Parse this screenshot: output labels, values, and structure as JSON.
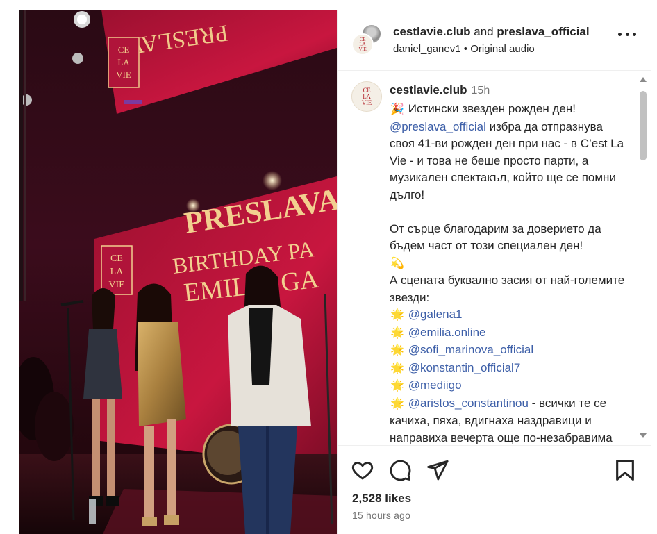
{
  "post": {
    "header": {
      "user1": "cestlavie.club",
      "and_word": "and",
      "user2": "preslava_official",
      "audio_user": "daniel_ganev1",
      "separator": "•",
      "audio_label": "Original audio",
      "more_icon": "more-horizontal-icon"
    },
    "logo": {
      "line1": "CE",
      "line2": "LA",
      "line3": "VIE"
    },
    "caption": {
      "username": "cestlavie.club",
      "time": "15h",
      "emoji_party": "🎉",
      "line_intro": "Истински звезден рожден ден!",
      "mention_preslava": "@preslava_official",
      "para1_rest": " избра да отпразнува своя 41-ви рожден ден при нас - в C’est La Vie - и това не беше просто парти, а музикален спектакъл, който ще се помни дълго!",
      "para2": "От сърце благодарим за доверието да бъдем част от този специален ден!",
      "emoji_dizzy": "💫",
      "para3": "А сцената буквално засия от най-големите звезди:",
      "emoji_sparkle": "🌟",
      "mentions": [
        "@galena1",
        "@emilia.online",
        "@sofi_marinova_official",
        "@konstantin_official7",
        "@mediigo",
        "@aristos_constantinou"
      ],
      "para4_rest": " - всички те се качиха, пяха, вдигнаха наздравици и направиха вечерта още по-незабравима"
    },
    "actions": {
      "like_icon": "heart-icon",
      "comment_icon": "comment-icon",
      "share_icon": "share-icon",
      "save_icon": "bookmark-icon"
    },
    "likes": "2,528 likes",
    "time_ago": "15 hours ago",
    "media": {
      "screen_text_1": "PRESLAVA",
      "screen_text_2": "BIRTHDAY PA",
      "screen_text_3": "EMILIA GA",
      "screen_text_top": "PRESLAVA",
      "screen_logo_1": "CE",
      "screen_logo_2": "LA",
      "screen_logo_3": "VIE"
    },
    "colors": {
      "accent_link": "#3d5fa8",
      "text": "#262626",
      "muted": "#737373",
      "stage_red": "#c2133a"
    }
  }
}
